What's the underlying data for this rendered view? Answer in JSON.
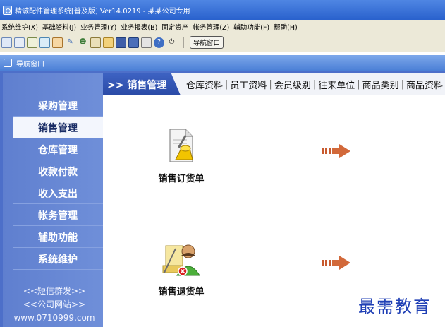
{
  "window": {
    "title": "精诚配件管理系统[普及版] Ver14.0219 - 某某公司专用"
  },
  "menubar": [
    "系统维护(X)",
    "基础资料(J)",
    "业务管理(Y)",
    "业务报表(B)",
    "固定资产",
    "帐务管理(Z)",
    "辅助功能(F)",
    "帮助(H)"
  ],
  "toolbar": {
    "nav_window_label": "导航窗口",
    "icons": [
      "new-doc-icon",
      "window-icon",
      "doc-list-icon",
      "message-icon",
      "calendar-icon",
      "tools-icon",
      "users-icon",
      "report-icon",
      "folder-icon",
      "card-icon",
      "save-icon",
      "print-icon",
      "help-icon",
      "exit-icon"
    ]
  },
  "nav_window": {
    "title": "导航窗口"
  },
  "sidebar": {
    "items": [
      {
        "label": "采购管理"
      },
      {
        "label": "销售管理",
        "active": true
      },
      {
        "label": "仓库管理"
      },
      {
        "label": "收款付款"
      },
      {
        "label": "收入支出"
      },
      {
        "label": "帐务管理"
      },
      {
        "label": "辅助功能"
      },
      {
        "label": "系统维护"
      }
    ],
    "links": [
      "<<短信群发>>",
      "<<公司网站>>",
      "www.0710999.com"
    ]
  },
  "content": {
    "current_module": ">> 销售管理",
    "tabs": [
      "仓库资料",
      "员工资料",
      "会员级别",
      "往来单位",
      "商品类别",
      "商品资料"
    ],
    "functions": [
      {
        "label": "销售订货单",
        "icon": "sales-order-icon"
      },
      {
        "label": "销售退货单",
        "icon": "sales-return-icon"
      }
    ]
  },
  "watermark": "最需教育",
  "colors": {
    "sidebar": "#6f8fd9",
    "active_item": "#f3f6fd",
    "module_header": "#2a4aa6",
    "arrow": "#d2693a"
  }
}
